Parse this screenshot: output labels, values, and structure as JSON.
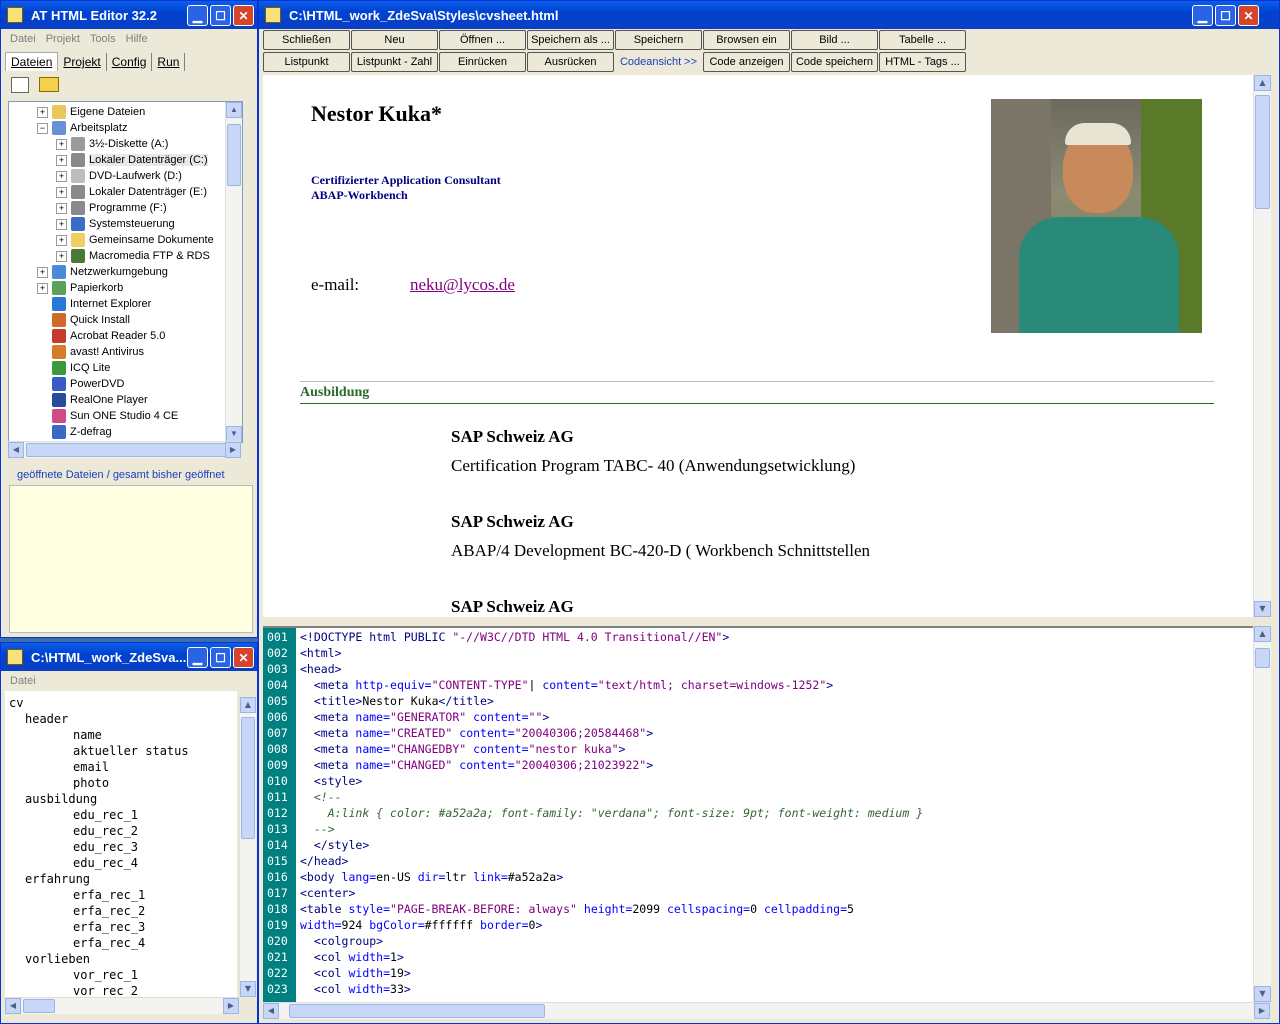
{
  "left_window": {
    "title": "AT HTML Editor 32.2",
    "menu": [
      "Datei",
      "Projekt",
      "Tools",
      "Hilfe"
    ],
    "tabs": [
      "Dateien",
      "Projekt",
      "Config",
      "Run"
    ],
    "tree": [
      {
        "label": "Eigene Dateien",
        "level": 1,
        "expander": "+",
        "icon_color": "#e8c85a"
      },
      {
        "label": "Arbeitsplatz",
        "level": 1,
        "expander": "−",
        "icon_color": "#6a8fd6"
      },
      {
        "label": "3½-Diskette (A:)",
        "level": 2,
        "expander": "+",
        "icon_color": "#9a9a9a"
      },
      {
        "label": "Lokaler Datenträger (C:)",
        "level": 2,
        "expander": "+",
        "icon_color": "#8a8a8a",
        "selected": true
      },
      {
        "label": "DVD-Laufwerk (D:)",
        "level": 2,
        "expander": "+",
        "icon_color": "#bdbdbd"
      },
      {
        "label": "Lokaler Datenträger (E:)",
        "level": 2,
        "expander": "+",
        "icon_color": "#8a8a8a"
      },
      {
        "label": "Programme (F:)",
        "level": 2,
        "expander": "+",
        "icon_color": "#8a8a8a"
      },
      {
        "label": "Systemsteuerung",
        "level": 2,
        "expander": "+",
        "icon_color": "#3a6cc8"
      },
      {
        "label": "Gemeinsame Dokumente",
        "level": 2,
        "expander": "+",
        "icon_color": "#f0d060"
      },
      {
        "label": "Macromedia FTP & RDS",
        "level": 2,
        "expander": "+",
        "icon_color": "#4a7a3a"
      },
      {
        "label": "Netzwerkumgebung",
        "level": 1,
        "expander": "+",
        "icon_color": "#4a8ad6"
      },
      {
        "label": "Papierkorb",
        "level": 1,
        "expander": "+",
        "icon_color": "#5aa05a"
      },
      {
        "label": "Internet Explorer",
        "level": 1,
        "expander": "",
        "icon_color": "#2a78d8"
      },
      {
        "label": "Quick Install",
        "level": 1,
        "expander": "",
        "icon_color": "#d06a2a"
      },
      {
        "label": "Acrobat Reader 5.0",
        "level": 1,
        "expander": "",
        "icon_color": "#c83a2a"
      },
      {
        "label": "avast! Antivirus",
        "level": 1,
        "expander": "",
        "icon_color": "#d87a2a"
      },
      {
        "label": "ICQ Lite",
        "level": 1,
        "expander": "",
        "icon_color": "#3a9a3a"
      },
      {
        "label": "PowerDVD",
        "level": 1,
        "expander": "",
        "icon_color": "#3a5ac8"
      },
      {
        "label": "RealOne Player",
        "level": 1,
        "expander": "",
        "icon_color": "#2a4a9a"
      },
      {
        "label": "Sun ONE Studio 4 CE",
        "level": 1,
        "expander": "",
        "icon_color": "#d04a8a"
      },
      {
        "label": "Z-defrag",
        "level": 1,
        "expander": "",
        "icon_color": "#3a6ac8"
      }
    ],
    "opened_files_label": "geöffnete Dateien / gesamt bisher geöffnet"
  },
  "outline_window": {
    "title": "C:\\HTML_work_ZdeSva...",
    "menu": [
      "Datei"
    ],
    "items": [
      {
        "label": "cv",
        "indent": 0
      },
      {
        "label": "header",
        "indent": 1
      },
      {
        "label": "name",
        "indent": 2
      },
      {
        "label": "aktueller status",
        "indent": 2
      },
      {
        "label": "email",
        "indent": 2
      },
      {
        "label": "photo",
        "indent": 2
      },
      {
        "label": "ausbildung",
        "indent": 1
      },
      {
        "label": "edu_rec_1",
        "indent": 2
      },
      {
        "label": "edu_rec_2",
        "indent": 2
      },
      {
        "label": "edu_rec_3",
        "indent": 2
      },
      {
        "label": "edu_rec_4",
        "indent": 2
      },
      {
        "label": "erfahrung",
        "indent": 1
      },
      {
        "label": "erfa_rec_1",
        "indent": 2
      },
      {
        "label": "erfa_rec_2",
        "indent": 2
      },
      {
        "label": "erfa_rec_3",
        "indent": 2
      },
      {
        "label": "erfa_rec_4",
        "indent": 2
      },
      {
        "label": "vorlieben",
        "indent": 1
      },
      {
        "label": "vor_rec_1",
        "indent": 2
      },
      {
        "label": "vor_rec_2",
        "indent": 2
      }
    ]
  },
  "main_window": {
    "title": "C:\\HTML_work_ZdeSva\\Styles\\cvsheet.html",
    "toolbar_row1": [
      "Schließen",
      "Neu",
      "Öffnen ...",
      "Speichern als ...",
      "Speichern",
      "Browsen ein",
      "Bild ...",
      "Tabelle ..."
    ],
    "toolbar_row2": [
      "Listpunkt",
      "Listpunkt - Zahl",
      "Einrücken",
      "Ausrücken",
      "Codeansicht >>",
      "Code anzeigen",
      "Code speichern",
      "HTML - Tags ..."
    ],
    "preview": {
      "name": "Nestor Kuka*",
      "subtitle_1": "Certifizierter Application Consultant",
      "subtitle_2": "ABAP-Workbench",
      "email_label": "e-mail:",
      "email_value": "neku@lycos.de",
      "section_heading": "Ausbildung",
      "entries": [
        {
          "company": "SAP Schweiz AG",
          "course": "Certification Program TABC- 40 (Anwendungsetwicklung)"
        },
        {
          "company": "SAP Schweiz AG",
          "course": "ABAP/4 Development BC-420-D ( Workbench Schnittstellen"
        },
        {
          "company": "SAP Schweiz AG",
          "course": ""
        }
      ]
    },
    "code_lines": [
      {
        "n": "001",
        "html": "<span class=\"t\">&lt;!DOCTYPE html PUBLIC </span><span class=\"v\">\"-//W3C//DTD HTML 4.0 Transitional//EN\"</span><span class=\"t\">&gt;</span>"
      },
      {
        "n": "002",
        "html": "<span class=\"t\">&lt;html&gt;</span>"
      },
      {
        "n": "003",
        "html": "<span class=\"t\">&lt;head&gt;</span>"
      },
      {
        "n": "004",
        "html": "  <span class=\"t\">&lt;meta </span><span class=\"a\">http-equiv=</span><span class=\"v\">\"CONTENT-TYPE\"</span>| <span class=\"a\">content=</span><span class=\"v\">\"text/html; charset=windows-1252\"</span><span class=\"t\">&gt;</span>"
      },
      {
        "n": "005",
        "html": "  <span class=\"t\">&lt;title&gt;</span>Nestor Kuka<span class=\"t\">&lt;/title&gt;</span>"
      },
      {
        "n": "006",
        "html": "  <span class=\"t\">&lt;meta </span><span class=\"a\">name=</span><span class=\"v\">\"GENERATOR\"</span> <span class=\"a\">content=</span><span class=\"v\">\"\"</span><span class=\"t\">&gt;</span>"
      },
      {
        "n": "007",
        "html": "  <span class=\"t\">&lt;meta </span><span class=\"a\">name=</span><span class=\"v\">\"CREATED\"</span> <span class=\"a\">content=</span><span class=\"v\">\"20040306;20584468\"</span><span class=\"t\">&gt;</span>"
      },
      {
        "n": "008",
        "html": "  <span class=\"t\">&lt;meta </span><span class=\"a\">name=</span><span class=\"v\">\"CHANGEDBY\"</span> <span class=\"a\">content=</span><span class=\"v\">\"nestor kuka\"</span><span class=\"t\">&gt;</span>"
      },
      {
        "n": "009",
        "html": "  <span class=\"t\">&lt;meta </span><span class=\"a\">name=</span><span class=\"v\">\"CHANGED\"</span> <span class=\"a\">content=</span><span class=\"v\">\"20040306;21023922\"</span><span class=\"t\">&gt;</span>"
      },
      {
        "n": "010",
        "html": "  <span class=\"t\">&lt;style&gt;</span>"
      },
      {
        "n": "011",
        "html": "  <span class=\"c\">&lt;!--</span>"
      },
      {
        "n": "012",
        "html": "    <span class=\"c\">A:link { color: #a52a2a; font-family: \"verdana\"; font-size: 9pt; font-weight: medium }</span>"
      },
      {
        "n": "013",
        "html": "  <span class=\"c\">--&gt;</span>"
      },
      {
        "n": "014",
        "html": "  <span class=\"t\">&lt;/style&gt;</span>"
      },
      {
        "n": "015",
        "html": "<span class=\"t\">&lt;/head&gt;</span>"
      },
      {
        "n": "016",
        "html": "<span class=\"t\">&lt;body </span><span class=\"a\">lang=</span>en-US <span class=\"a\">dir=</span>ltr <span class=\"a\">link=</span>#a52a2a<span class=\"t\">&gt;</span>"
      },
      {
        "n": "017",
        "html": "<span class=\"t\">&lt;center&gt;</span>"
      },
      {
        "n": "018",
        "html": "<span class=\"t\">&lt;table </span><span class=\"a\">style=</span><span class=\"v\">\"PAGE-BREAK-BEFORE: always\"</span> <span class=\"a\">height=</span>2099 <span class=\"a\">cellspacing=</span>0 <span class=\"a\">cellpadding=</span>5"
      },
      {
        "n": "019",
        "html": "<span class=\"a\">width=</span>924 <span class=\"a\">bgColor=</span>#ffffff <span class=\"a\">border=</span>0<span class=\"t\">&gt;</span>"
      },
      {
        "n": "020",
        "html": "  <span class=\"t\">&lt;colgroup&gt;</span>"
      },
      {
        "n": "021",
        "html": "  <span class=\"t\">&lt;col </span><span class=\"a\">width=</span>1<span class=\"t\">&gt;</span>"
      },
      {
        "n": "022",
        "html": "  <span class=\"t\">&lt;col </span><span class=\"a\">width=</span>19<span class=\"t\">&gt;</span>"
      },
      {
        "n": "023",
        "html": "  <span class=\"t\">&lt;col </span><span class=\"a\">width=</span>33<span class=\"t\">&gt;</span>"
      }
    ]
  }
}
